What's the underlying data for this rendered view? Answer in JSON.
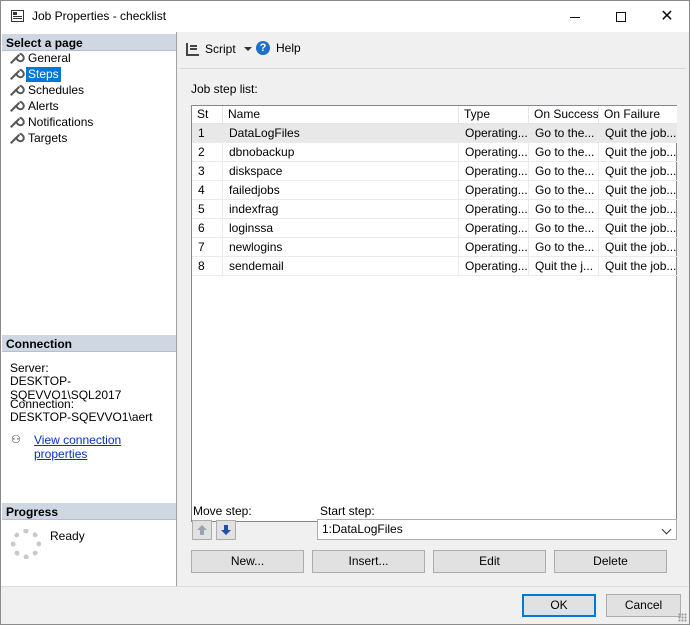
{
  "window": {
    "title": "Job Properties - checklist",
    "controls": {
      "minimize": "–",
      "maximize": "☐",
      "close": "✕"
    }
  },
  "left_pane": {
    "select_page_header": "Select a page",
    "pages": [
      {
        "label": "General",
        "icon": "wrench-icon",
        "selected": false
      },
      {
        "label": "Steps",
        "icon": "wrench-icon",
        "selected": true
      },
      {
        "label": "Schedules",
        "icon": "wrench-icon",
        "selected": false
      },
      {
        "label": "Alerts",
        "icon": "wrench-icon",
        "selected": false
      },
      {
        "label": "Notifications",
        "icon": "wrench-icon",
        "selected": false
      },
      {
        "label": "Targets",
        "icon": "wrench-icon",
        "selected": false
      }
    ],
    "connection": {
      "header": "Connection",
      "server_label": "Server:",
      "server_value": "DESKTOP-SQEVVO1\\SQL2017",
      "connection_label": "Connection:",
      "connection_value": "DESKTOP-SQEVVO1\\aert",
      "view_link": "View connection properties"
    },
    "progress": {
      "header": "Progress",
      "status": "Ready"
    }
  },
  "toolbar": {
    "script_label": "Script",
    "help_label": "Help"
  },
  "steps": {
    "list_label": "Job step list:",
    "columns": [
      "St",
      "Name",
      "Type",
      "On Success",
      "On Failure"
    ],
    "rows": [
      [
        "1",
        "DataLogFiles",
        "Operating...",
        "Go to the...",
        "Quit the job..."
      ],
      [
        "2",
        "dbnobackup",
        "Operating...",
        "Go to the...",
        "Quit the job..."
      ],
      [
        "3",
        "diskspace",
        "Operating...",
        "Go to the...",
        "Quit the job..."
      ],
      [
        "4",
        "failedjobs",
        "Operating...",
        "Go to the...",
        "Quit the job..."
      ],
      [
        "5",
        "indexfrag",
        "Operating...",
        "Go to the...",
        "Quit the job..."
      ],
      [
        "6",
        "loginssa",
        "Operating...",
        "Go to the...",
        "Quit the job..."
      ],
      [
        "7",
        "newlogins",
        "Operating...",
        "Go to the...",
        "Quit the job..."
      ],
      [
        "8",
        "sendemail",
        "Operating...",
        "Quit the j...",
        "Quit the job..."
      ]
    ],
    "selected_row": 0,
    "move_step_label": "Move step:",
    "start_step_label": "Start step:",
    "start_step_value": "1:DataLogFiles",
    "buttons": {
      "new": "New...",
      "insert": "Insert...",
      "edit": "Edit",
      "delete": "Delete"
    }
  },
  "footer": {
    "ok": "OK",
    "cancel": "Cancel"
  },
  "colors": {
    "accent": "#0078d7",
    "section_header": "#cfd7e2",
    "link": "#0033cc"
  }
}
